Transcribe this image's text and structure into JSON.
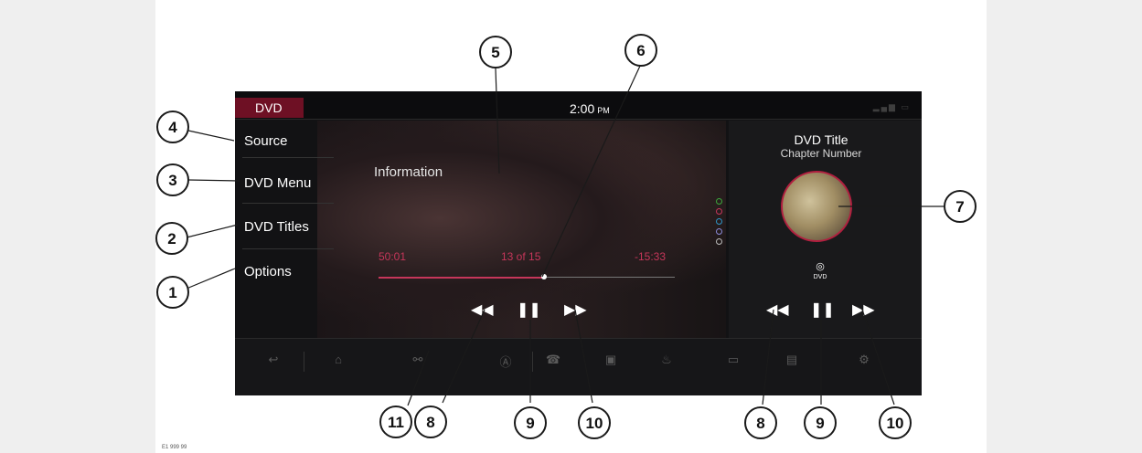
{
  "status_bar": {
    "source_tag": "DVD",
    "time": "2:00",
    "ampm": "PM"
  },
  "menu": {
    "items": [
      {
        "label": "Source"
      },
      {
        "label": "DVD Menu"
      },
      {
        "label": "DVD Titles"
      },
      {
        "label": "Options"
      }
    ]
  },
  "playback": {
    "info_label": "Information",
    "elapsed": "50:01",
    "chapter_count": "13 of 15",
    "remaining": "-15:33",
    "progress": 0.56,
    "controls": {
      "rewind": "◀◀",
      "pause": "❚❚",
      "fast_forward": "▶▶"
    }
  },
  "color_dots": [
    "#3ca83c",
    "#c7365c",
    "#2f95c7",
    "#8a8ad8",
    "#bbbbbb"
  ],
  "now_playing": {
    "title": "DVD Title",
    "chapter_label": "Chapter Number",
    "disc_icon_text": "DVD"
  },
  "nav_bar": {
    "icons": [
      "back-icon",
      "home-icon",
      "link-icon",
      "nav-icon",
      "phone-icon",
      "media-icon",
      "climate-icon",
      "camera-icon",
      "tv-icon",
      "settings-icon"
    ]
  },
  "callouts": [
    "1",
    "2",
    "3",
    "4",
    "5",
    "6",
    "7",
    "8",
    "9",
    "10",
    "11",
    "8",
    "9",
    "10"
  ],
  "figure_code": "E1 999 99"
}
